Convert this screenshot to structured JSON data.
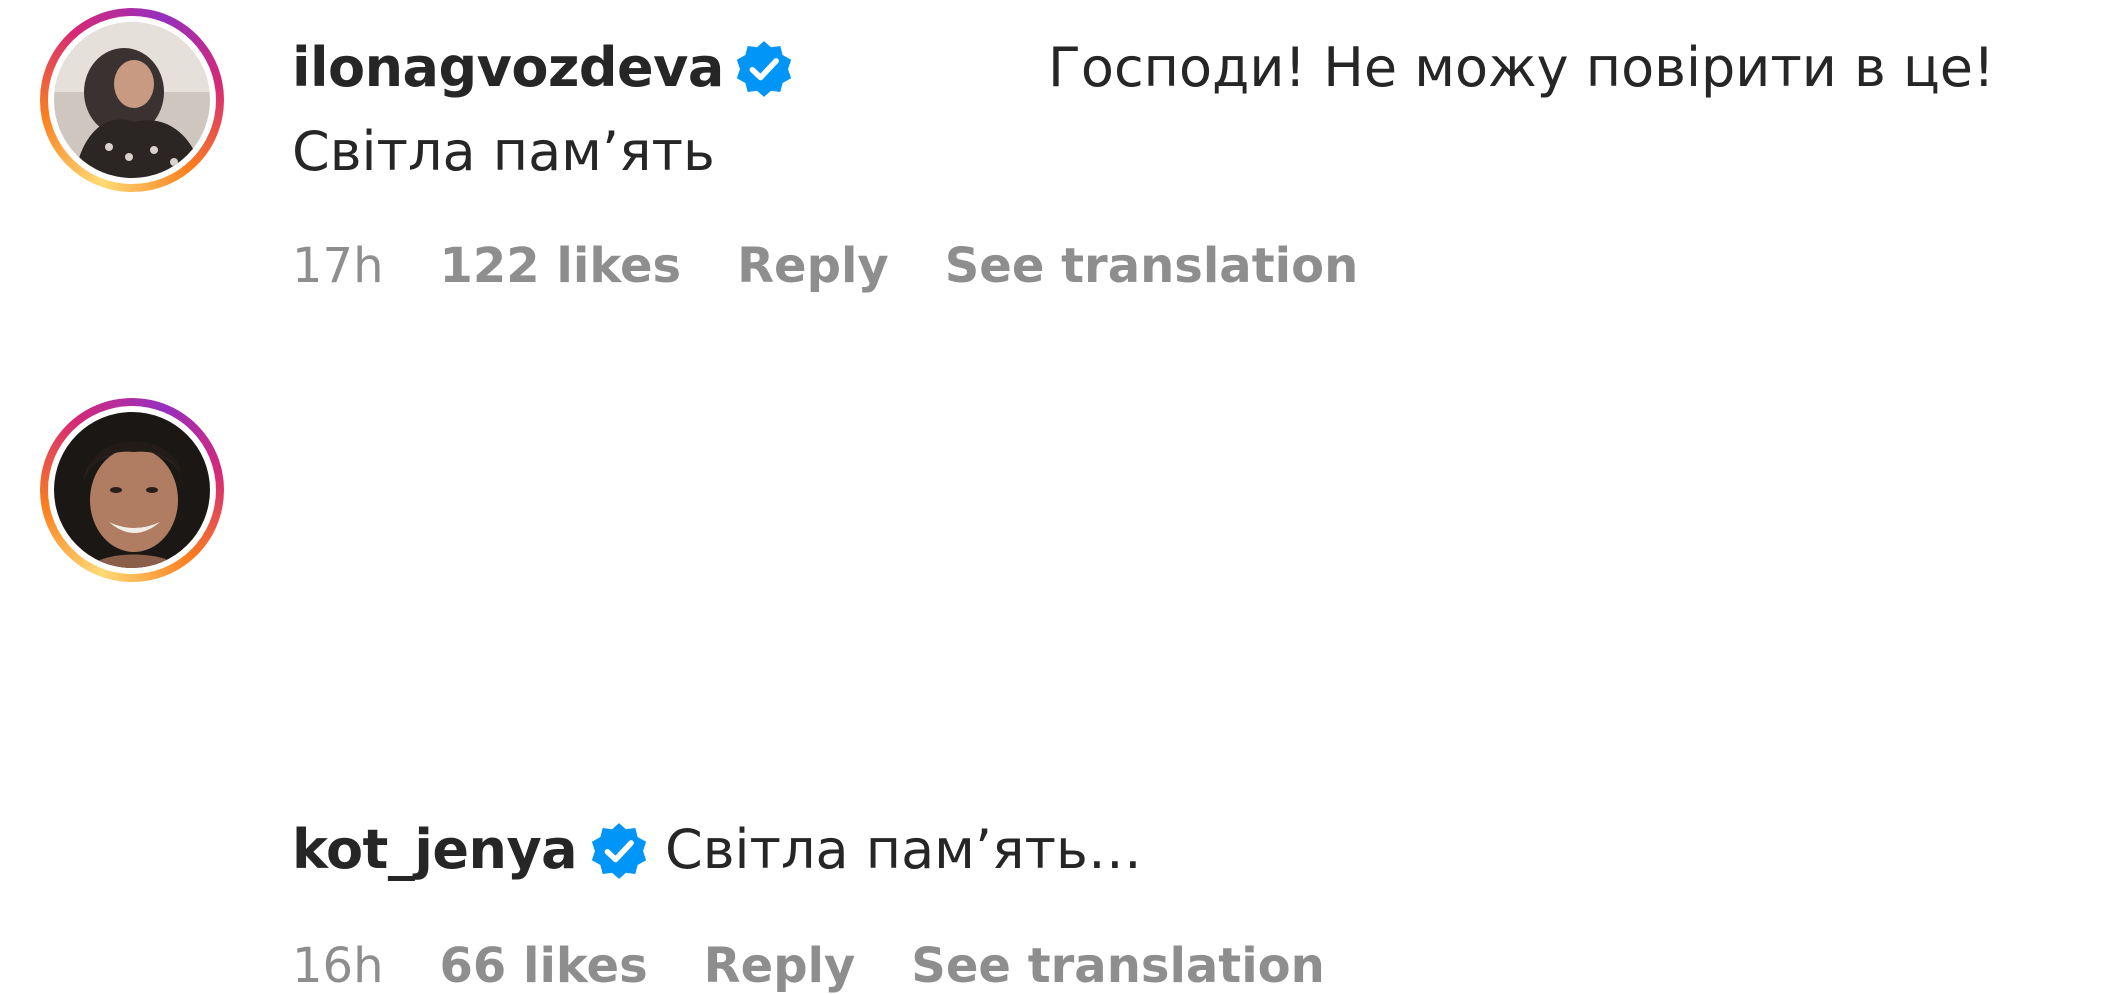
{
  "comments": [
    {
      "username": "ilonagvozdeva",
      "verified": true,
      "text_line1": "Господи! Не можу повірити в це!",
      "text_line2": "Світла пам’ять",
      "time": "17h",
      "likes": "122 likes",
      "reply_label": "Reply",
      "translate_label": "See translation"
    },
    {
      "username": "kot_jenya",
      "verified": true,
      "text_line1": "Світла пам’ять…",
      "time": "16h",
      "likes": "66 likes",
      "reply_label": "Reply",
      "translate_label": "See translation"
    }
  ],
  "colors": {
    "text": "#262626",
    "meta": "#8e8e8e",
    "verified": "#0095f6",
    "story_ring_start": "#feda75",
    "story_ring_end": "#962fbf"
  },
  "icons": {
    "verified": "verified-badge-icon",
    "avatar": "avatar-image"
  }
}
